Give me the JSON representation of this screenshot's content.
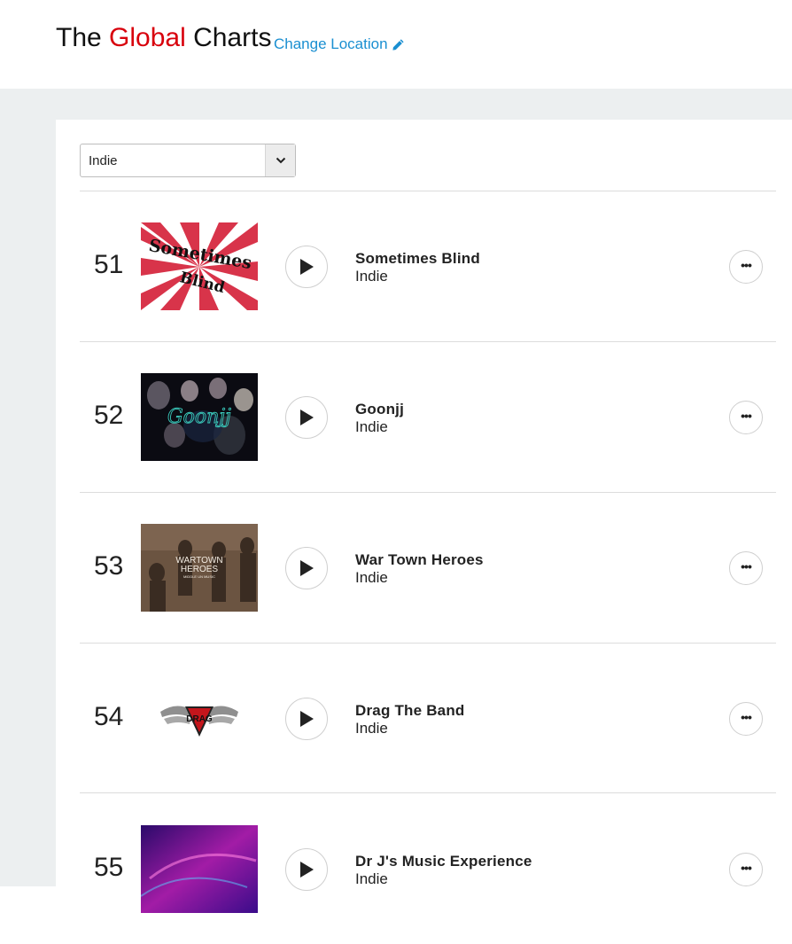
{
  "header": {
    "title_part1": "The ",
    "title_accent": "Global",
    "title_part2": " Charts",
    "change_location": "Change Location",
    "accent_color": "#d8000c",
    "link_color": "#1a8fd1"
  },
  "filter": {
    "selected": "Indie"
  },
  "chart": [
    {
      "rank": "51",
      "name": "Sometimes Blind",
      "genre": "Indie",
      "art_text_top": "Sometimes",
      "art_text_bottom": "Blind"
    },
    {
      "rank": "52",
      "name": "Goonjj",
      "genre": "Indie",
      "art_text": "Goonjj"
    },
    {
      "rank": "53",
      "name": "War Town Heroes",
      "genre": "Indie",
      "art_text_top": "WARTOWN",
      "art_text_mid": "HEROES",
      "art_text_bottom": "MIDDLE UN MUSIC"
    },
    {
      "rank": "54",
      "name": "Drag The Band",
      "genre": "Indie",
      "art_text": "DRAG"
    },
    {
      "rank": "55",
      "name": "Dr J's Music Experience",
      "genre": "Indie"
    }
  ],
  "icons": {
    "edit": "pencil-icon",
    "dropdown": "chevron-down-icon",
    "play": "play-icon",
    "more": "more-options-icon"
  }
}
